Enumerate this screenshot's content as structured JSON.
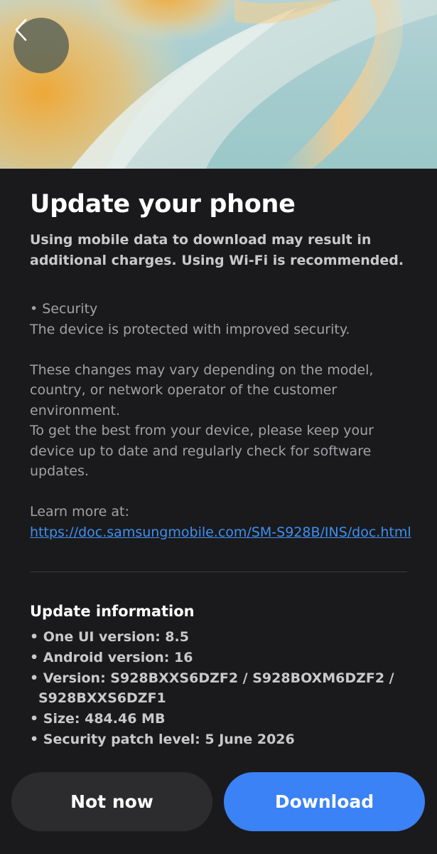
{
  "header": {
    "back_icon": "chevron-left-icon"
  },
  "main": {
    "title": "Update your phone",
    "subtitle": "Using mobile data to download may result in additional charges. Using Wi-Fi is recommended.",
    "bullet_security": "• Security",
    "security_desc": "The device is protected with improved security.",
    "changes_note": "These changes may vary depending on the model, country, or network operator of the customer environment.",
    "best_note": "To get the best from your device, please keep your device up to date and regularly check for software updates.",
    "learn_more_label": "Learn more at:",
    "learn_more_link": "https://doc.samsungmobile.com/SM-S928B/INS/doc.html"
  },
  "update_info": {
    "title": "Update information",
    "items": [
      "• One UI version: 8.5",
      "• Android version: 16",
      "• Version: S928BXXS6DZF2 / S928BOXM6DZF2 / S928BXXS6DZF1",
      "• Size: 484.46 MB",
      "• Security patch level: 5 June 2026"
    ]
  },
  "footer": {
    "not_now_label": "Not now",
    "download_label": "Download"
  },
  "colors": {
    "background": "#1a1a1c",
    "accent_button": "#3a82f6",
    "link": "#3f8ff0"
  }
}
